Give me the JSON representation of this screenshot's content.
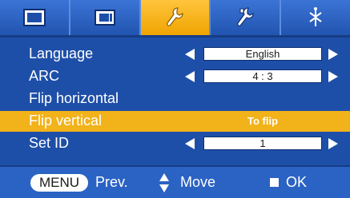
{
  "tabs": [
    {
      "icon": "picture-icon",
      "active": false
    },
    {
      "icon": "screen-icon",
      "active": false
    },
    {
      "icon": "wrench-icon",
      "active": true
    },
    {
      "icon": "tools-icon",
      "active": false
    },
    {
      "icon": "input-icon",
      "active": false
    }
  ],
  "menu": {
    "items": [
      {
        "label": "Language",
        "value": "English",
        "type": "selector"
      },
      {
        "label": "ARC",
        "value": "4 : 3",
        "type": "selector"
      },
      {
        "label": "Flip horizontal",
        "value": "",
        "type": "action"
      },
      {
        "label": "Flip vertical",
        "value": "To flip",
        "type": "action",
        "selected": true
      },
      {
        "label": "Set ID",
        "value": "1",
        "type": "selector"
      }
    ]
  },
  "help": {
    "menu_label": "MENU",
    "prev_label": "Prev.",
    "move_label": "Move",
    "ok_label": "OK"
  },
  "colors": {
    "background": "#1e4fa8",
    "highlight": "#f2b21a",
    "text": "#ffffff"
  }
}
